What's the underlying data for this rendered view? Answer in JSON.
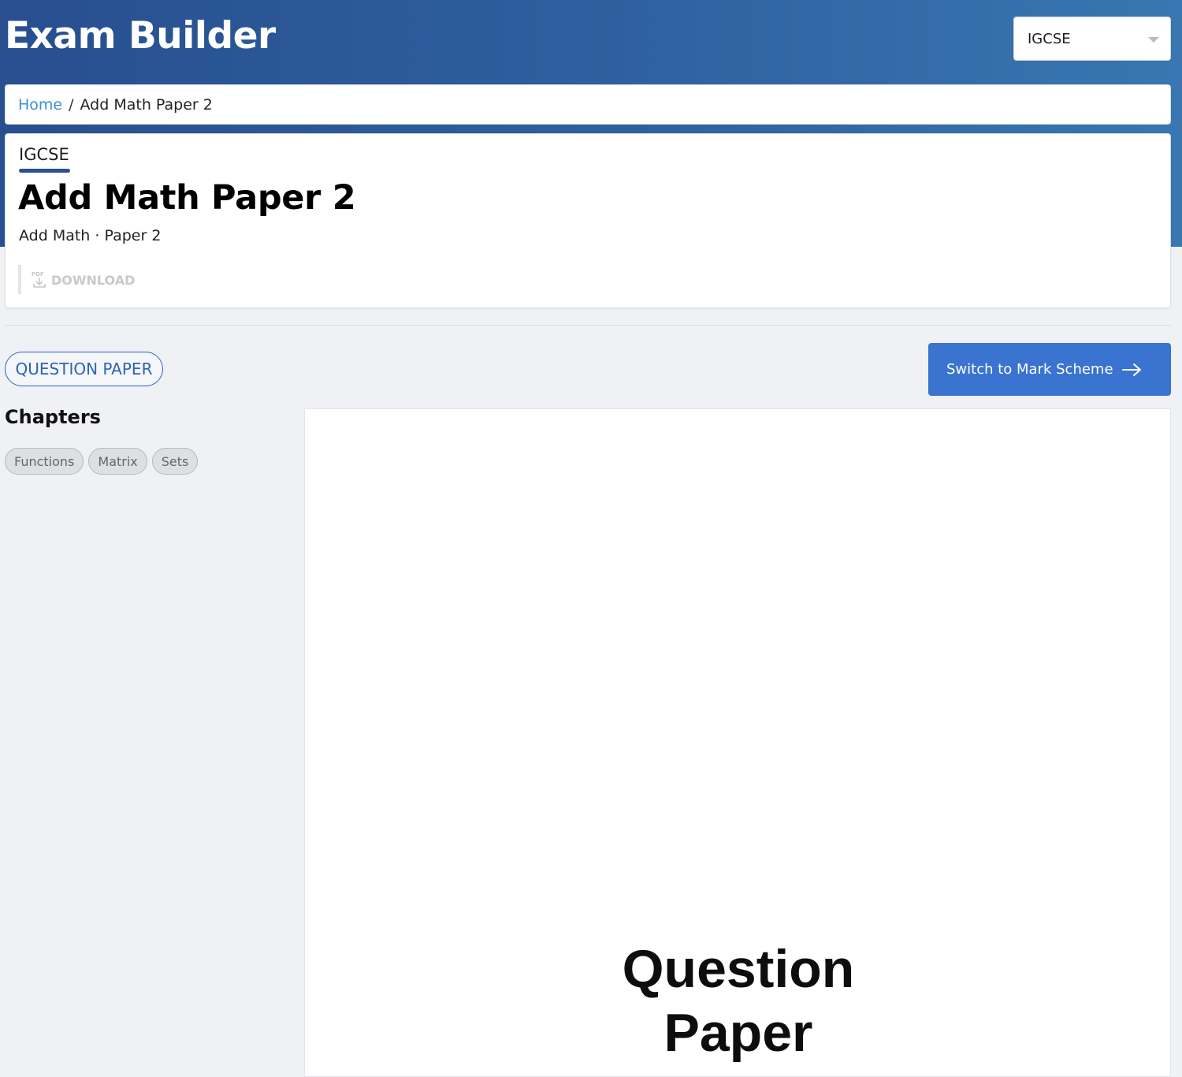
{
  "header": {
    "app_title": "Exam Builder",
    "board_select": {
      "selected": "IGCSE"
    }
  },
  "breadcrumb": {
    "home": "Home",
    "separator": "/",
    "current": "Add Math Paper 2"
  },
  "paper": {
    "board": "IGCSE",
    "title": "Add Math Paper 2",
    "subtitle": "Add Math · Paper 2",
    "download_label": "DOWNLOAD",
    "pdf_icon_label": "PDF"
  },
  "tabs": {
    "question_paper": "QUESTION PAPER",
    "switch_label": "Switch to Mark Scheme"
  },
  "chapters": {
    "heading": "Chapters",
    "items": [
      "Functions",
      "Matrix",
      "Sets"
    ]
  },
  "viewer": {
    "title_line1": "Question",
    "title_line2": "Paper"
  },
  "colors": {
    "header_start": "#284f8f",
    "header_end": "#3877b1",
    "primary_button": "#3a73d0",
    "link": "#3b8fd6"
  }
}
